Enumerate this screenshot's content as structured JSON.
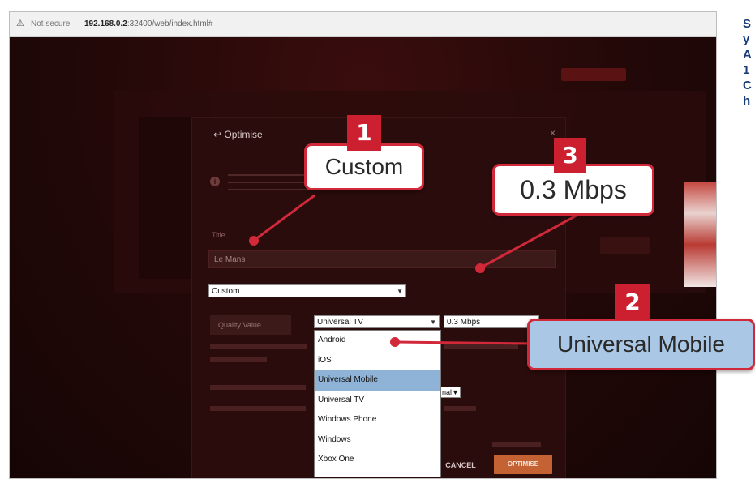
{
  "browser": {
    "warning_icon": "warning-triangle-icon",
    "security_label": "Not secure",
    "url_host": "192.168.0.2",
    "url_rest": ":32400/web/index.html#"
  },
  "dialog": {
    "title_icon": "optimise-icon",
    "title": "Optimise",
    "close_icon": "close-icon",
    "title_field_label": "Title",
    "title_field_value": "Le Mans",
    "preset_select": "Custom",
    "quality_button": "Quality Value",
    "device_select": "Universal TV",
    "bitrate_select": "0.3 Mbps",
    "partial_select": "nal",
    "device_options": [
      "Android",
      "iOS",
      "Universal Mobile",
      "Universal TV",
      "Windows Phone",
      "Windows",
      "Xbox One"
    ],
    "device_highlighted": "Universal Mobile",
    "cancel_button": "CANCEL",
    "optimise_button": "OPTIMISE"
  },
  "callouts": [
    {
      "number": "1",
      "label": "Custom"
    },
    {
      "number": "2",
      "label": "Universal Mobile"
    },
    {
      "number": "3",
      "label": "0.3 Mbps"
    }
  ],
  "side_text": [
    "S",
    "y",
    "A",
    "1",
    "C",
    "h"
  ],
  "colors": {
    "callout_red": "#d1283a",
    "highlight_blue": "#aac8e6",
    "optimise_orange": "#c56234",
    "side_text_blue": "#1a3b7a"
  }
}
